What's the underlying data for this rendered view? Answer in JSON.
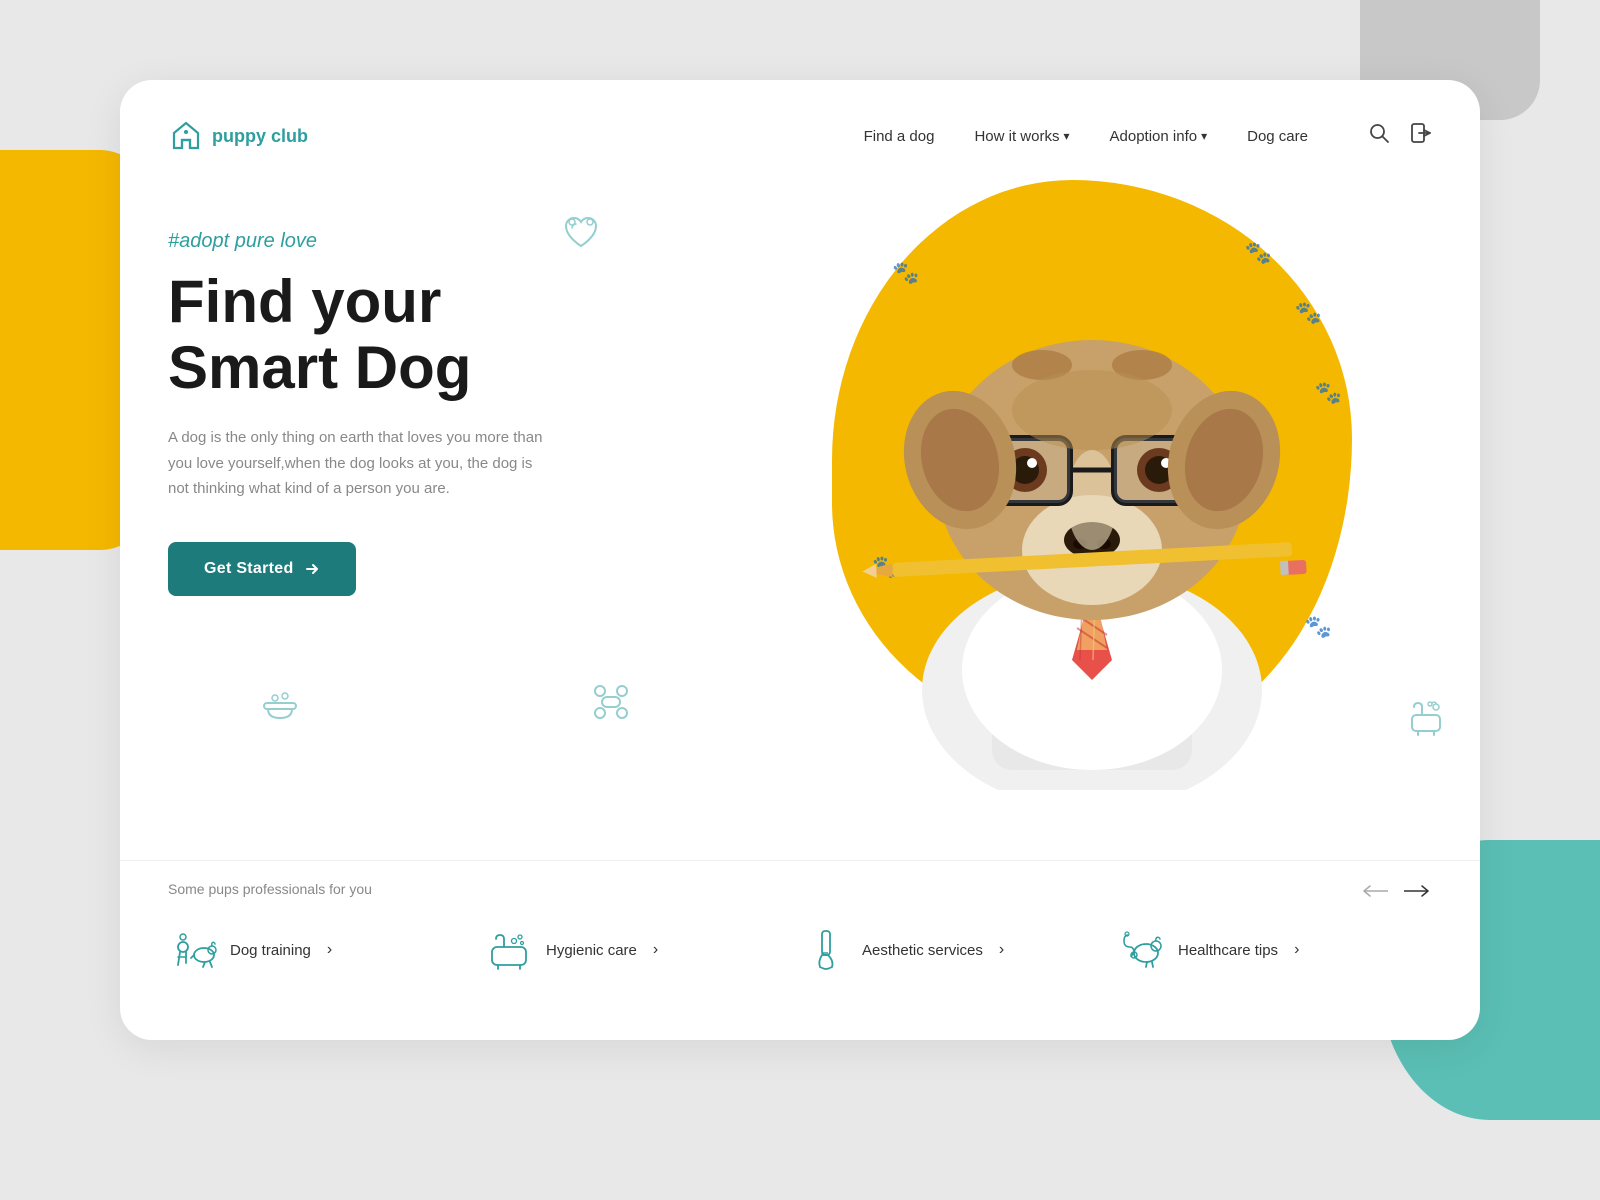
{
  "background": {
    "colors": {
      "yellow": "#F5B800",
      "teal": "#5BBFB5",
      "gray": "#c8c8c8",
      "card": "#ffffff",
      "page": "#e8e8e8"
    }
  },
  "logo": {
    "text": "puppy club",
    "icon": "home-icon",
    "color": "#2E9E9E"
  },
  "nav": {
    "links": [
      {
        "label": "Find a dog",
        "hasDropdown": false
      },
      {
        "label": "How it works",
        "hasDropdown": true
      },
      {
        "label": "Adoption info",
        "hasDropdown": true
      },
      {
        "label": "Dog care",
        "hasDropdown": false
      }
    ],
    "icons": [
      "search-icon",
      "login-icon"
    ]
  },
  "hero": {
    "hashtag": "#adopt pure love",
    "title_line1": "Find your",
    "title_line2": "Smart Dog",
    "description": "A dog is the only thing on earth that loves you more than you love yourself,when the dog looks at you, the dog is not thinking what kind of a person you are.",
    "cta_button": "Get Started"
  },
  "services": {
    "section_label": "Some pups professionals for you",
    "items": [
      {
        "name": "Dog training",
        "icon": "dog-training-icon"
      },
      {
        "name": "Hygienic care",
        "icon": "hygienic-care-icon"
      },
      {
        "name": "Aesthetic services",
        "icon": "aesthetic-services-icon"
      },
      {
        "name": "Healthcare tips",
        "icon": "healthcare-tips-icon"
      }
    ],
    "nav_prev": "←",
    "nav_next": "→"
  }
}
